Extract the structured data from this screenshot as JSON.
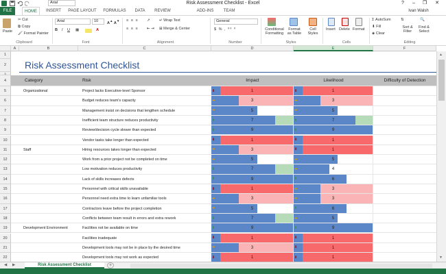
{
  "window": {
    "title": "Risk Assessment Checklist - Excel",
    "user": "Ivan Walsh",
    "font_box": "Arial"
  },
  "tabs": [
    "FILE",
    "HOME",
    "INSERT",
    "PAGE LAYOUT",
    "FORMULAS",
    "DATA",
    "REVIEW",
    "ADD-INS",
    "TEAM"
  ],
  "ribbon": {
    "clipboard": {
      "paste": "Paste",
      "cut": "Cut",
      "copy": "Copy",
      "format_painter": "Format Painter",
      "group": "Clipboard"
    },
    "font": {
      "name": "Arial",
      "size": "10",
      "group": "Font"
    },
    "alignment": {
      "wrap_text": "Wrap Text",
      "merge_center": "Merge & Center",
      "group": "Alignment"
    },
    "number": {
      "format": "General",
      "group": "Number"
    },
    "styles": {
      "conditional": "Conditional Formatting",
      "format_table": "Format as Table",
      "cell_styles": "Cell Styles",
      "group": "Styles"
    },
    "cells": {
      "insert": "Insert",
      "delete": "Delete",
      "format": "Format",
      "group": "Cells"
    },
    "editing": {
      "autosum": "AutoSum",
      "fill": "Fill",
      "clear": "Clear",
      "sort": "Sort & Filter",
      "find": "Find & Select",
      "group": "Editing"
    }
  },
  "columns": [
    "A",
    "B",
    "C",
    "D",
    "E",
    "F"
  ],
  "sheet_title": "Risk Assessment Checklist",
  "table_headers": {
    "category": "Category",
    "risk": "Risk",
    "impact": "Impact",
    "likelihood": "Likelihood",
    "difficulty": "Difficulty of Detection"
  },
  "rows": [
    {
      "n": "5",
      "category": "Organizational",
      "risk": "Project lacks Executive-level Sponsor",
      "impact": 1,
      "likelihood": 1
    },
    {
      "n": "6",
      "category": "",
      "risk": "Budget reduces team's capacity",
      "impact": 3,
      "likelihood": 3
    },
    {
      "n": "7",
      "category": "",
      "risk": "Management insist on decisions that lengthen schedule",
      "impact": 5,
      "likelihood": 5
    },
    {
      "n": "8",
      "category": "",
      "risk": "Inefficient team structure reduces productivity",
      "impact": 7,
      "likelihood": 7
    },
    {
      "n": "9",
      "category": "",
      "risk": "Review/decision cycle slower than expected",
      "impact": 9,
      "likelihood": 9
    },
    {
      "n": "10",
      "category": "",
      "risk": "Vendor tasks take longer than expected",
      "impact": 1,
      "likelihood": 1
    },
    {
      "n": "11",
      "category": "Staff",
      "risk": "Hiring resources takes longer than expected",
      "impact": 3,
      "likelihood": 1
    },
    {
      "n": "12",
      "category": "",
      "risk": "Work from a prior project not be completed on time",
      "impact": 5,
      "likelihood": 5
    },
    {
      "n": "13",
      "category": "",
      "risk": "Low motivation reduces productivity",
      "impact": 7,
      "likelihood": 4
    },
    {
      "n": "14",
      "category": "",
      "risk": "Lack of skills increases defects",
      "impact": 9,
      "likelihood": 6
    },
    {
      "n": "15",
      "category": "",
      "risk": "Personnel with critical skills unavailable",
      "impact": 1,
      "likelihood": 3
    },
    {
      "n": "16",
      "category": "",
      "risk": "Personnel need extra time to learn unfamiliar tools",
      "impact": 3,
      "likelihood": 3
    },
    {
      "n": "17",
      "category": "",
      "risk": "Contractors leave before the project completion",
      "impact": 5,
      "likelihood": 6
    },
    {
      "n": "18",
      "category": "",
      "risk": "Conflicts between team  result in errors and extra rework",
      "impact": 7,
      "likelihood": 5
    },
    {
      "n": "19",
      "category": "Development Environment",
      "risk": "Facilities  not be available on time",
      "impact": 9,
      "likelihood": 9
    },
    {
      "n": "20",
      "category": "",
      "risk": "Facilities  inadequate",
      "impact": 1,
      "likelihood": 1
    },
    {
      "n": "21",
      "category": "",
      "risk": "Development tools may not be in place by the desired time",
      "impact": 3,
      "likelihood": 1
    },
    {
      "n": "22",
      "category": "",
      "risk": "Development tools may not work as expected",
      "impact": 1,
      "likelihood": 1
    }
  ],
  "row_numbers": [
    "1",
    "2",
    "3",
    "4"
  ],
  "sheet_tab": "Risk Assessment Checklist",
  "colors": {
    "accent": "#217346",
    "bar_blue": "#5b86c7",
    "red": "#f8696b",
    "pink": "#fbb4b5",
    "green": "#b6dbb8",
    "header_gray": "#bfbfbf"
  }
}
